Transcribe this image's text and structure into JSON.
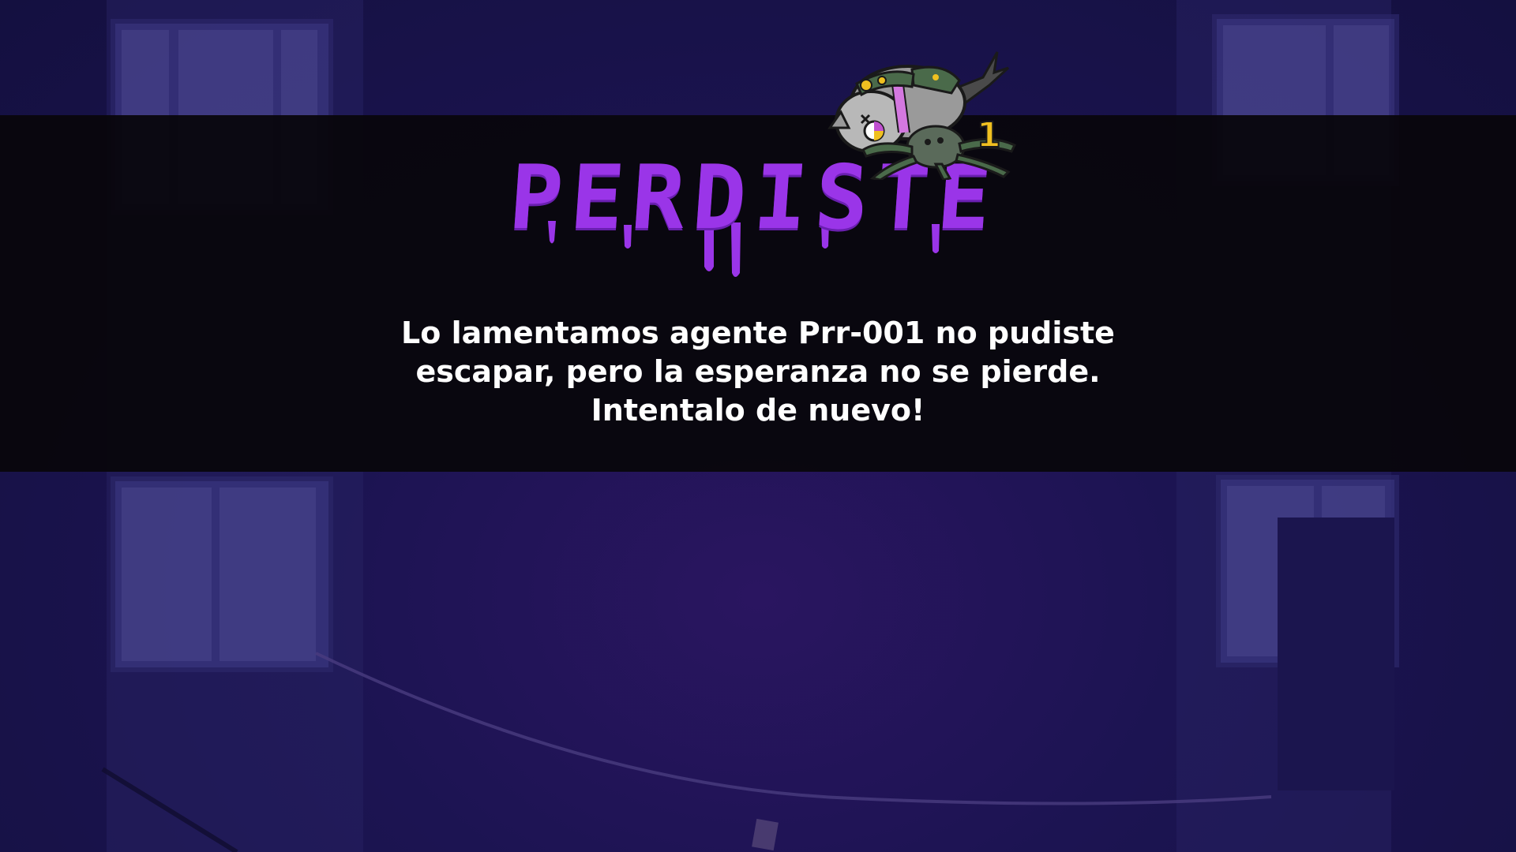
{
  "game_over": {
    "title": "PERDISTE",
    "message": "Lo lamentamos agente Prr-001 no pudiste escapar, pero la esperanza no se pierde. Intentalo de nuevo!",
    "title_color": "#9a35e8",
    "message_color": "#ffffff"
  },
  "mascot": {
    "icon": "defeated-cat-spider-icon",
    "tag_number": "1"
  },
  "background": {
    "banner_color": "#08060c",
    "night_color": "#16123f"
  }
}
